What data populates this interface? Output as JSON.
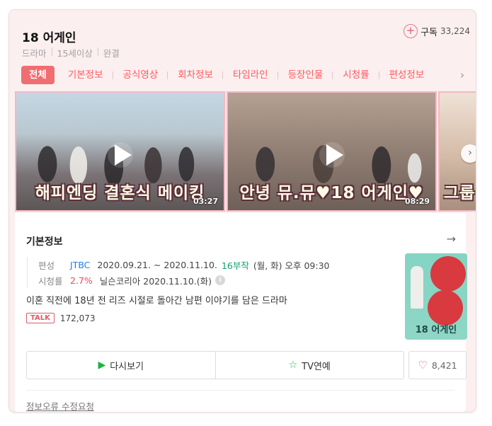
{
  "header": {
    "title": "18 어게인",
    "meta": [
      "드라마",
      "15세이상",
      "완결"
    ],
    "subscribe_label": "구독",
    "subscribe_count": "33,224"
  },
  "tabs": [
    "전체",
    "기본정보",
    "공식영상",
    "회차정보",
    "타임라인",
    "등장인물",
    "시청률",
    "편성정보"
  ],
  "videos": [
    {
      "caption": "해피엔딩 결혼식 메이킹",
      "duration": "03:27"
    },
    {
      "caption": "안녕 뮤.뮤♥18 어게인♥",
      "duration": "08:29"
    },
    {
      "caption": "그룹",
      "duration": ""
    }
  ],
  "info": {
    "title": "기본정보",
    "schedule_label": "편성",
    "broadcaster": "JTBC",
    "dates": "2020.09.21. ~ 2020.11.10.",
    "episodes": "16부작",
    "days": "(월, 화) 오후 09:30",
    "rating_label": "시청률",
    "rating": "2.7%",
    "rating_source": "닐슨코리아 2020.11.10.(화)",
    "description": "이혼 직전에 18년 전 리즈 시절로 돌아간 남편 이야기를 담은 드라마",
    "talk_badge": "TALK",
    "talk_count": "172,073",
    "poster_title": "18 어게인"
  },
  "actions": {
    "rewatch": "다시보기",
    "tv_entertain": "TV연예",
    "like_count": "8,421"
  },
  "report_link": "정보오류 수정요청",
  "colors": {
    "accent": "#f06d71",
    "card_bg": "#fbeff0",
    "link_blue": "#1e7ee5",
    "green": "#13a06e"
  }
}
